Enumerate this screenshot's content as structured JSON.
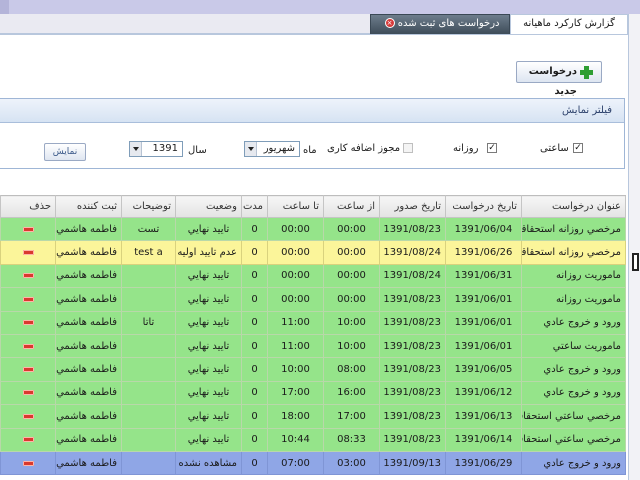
{
  "tabs": {
    "active_label": "گزارش کارکرد ماهیانه",
    "second_label": "درخواست های ثبت شده"
  },
  "toolbar": {
    "new_request_label": "درخواست جدید"
  },
  "filter": {
    "header": "فیلتر نمایش",
    "hourly_label": "ساعتی",
    "daily_label": "روزانه",
    "overtime_label": "مجوز اضافه کاری",
    "month_label": "ماه",
    "month_value": "شهریور",
    "year_label": "سال",
    "year_value": "1391",
    "show_button": "نمایش"
  },
  "columns": {
    "title": "عنوان درخواست",
    "request_date": "تاریخ درخواست",
    "issue_date": "تاریخ صدور",
    "from_hour": "از ساعت",
    "to_hour": "تا ساعت",
    "duration": "مدت",
    "status": "وضعیت",
    "notes": "توضیحات",
    "registrar": "ثبت کننده",
    "delete": "حذف"
  },
  "rows": [
    {
      "title": "مرخصي روزانه استحقاقي",
      "request_date": "1391/06/04",
      "issue_date": "1391/08/23",
      "from_hour": "00:00",
      "to_hour": "00:00",
      "duration": "0",
      "status": "تاييد نهايي",
      "notes": "تست",
      "registrar": "فاطمه هاشمي"
    },
    {
      "title": "مرخصي روزانه استحقاقي",
      "request_date": "1391/06/26",
      "issue_date": "1391/08/24",
      "from_hour": "00:00",
      "to_hour": "00:00",
      "duration": "0",
      "status": "عدم تاييد اوليه",
      "notes": "test a",
      "registrar": "فاطمه هاشمي"
    },
    {
      "title": "ماموريت روزانه",
      "request_date": "1391/06/31",
      "issue_date": "1391/08/24",
      "from_hour": "00:00",
      "to_hour": "00:00",
      "duration": "0",
      "status": "تاييد نهايي",
      "notes": "",
      "registrar": "فاطمه هاشمي"
    },
    {
      "title": "ماموريت روزانه",
      "request_date": "1391/06/01",
      "issue_date": "1391/08/23",
      "from_hour": "00:00",
      "to_hour": "00:00",
      "duration": "0",
      "status": "تاييد نهايي",
      "notes": "",
      "registrar": "فاطمه هاشمي"
    },
    {
      "title": "ورود و خروج عادي",
      "request_date": "1391/06/01",
      "issue_date": "1391/08/23",
      "from_hour": "10:00",
      "to_hour": "11:00",
      "duration": "0",
      "status": "تاييد نهايي",
      "notes": "تاتا",
      "registrar": "فاطمه هاشمي"
    },
    {
      "title": "ماموريت ساعتي",
      "request_date": "1391/06/01",
      "issue_date": "1391/08/23",
      "from_hour": "10:00",
      "to_hour": "11:00",
      "duration": "0",
      "status": "تاييد نهايي",
      "notes": "",
      "registrar": "فاطمه هاشمي"
    },
    {
      "title": "ورود و خروج عادي",
      "request_date": "1391/06/05",
      "issue_date": "1391/08/23",
      "from_hour": "08:00",
      "to_hour": "10:00",
      "duration": "0",
      "status": "تاييد نهايي",
      "notes": "",
      "registrar": "فاطمه هاشمي"
    },
    {
      "title": "ورود و خروج عادي",
      "request_date": "1391/06/12",
      "issue_date": "1391/08/23",
      "from_hour": "16:00",
      "to_hour": "17:00",
      "duration": "0",
      "status": "تاييد نهايي",
      "notes": "",
      "registrar": "فاطمه هاشمي"
    },
    {
      "title": "مرخصي ساعتي استحقاقي",
      "request_date": "1391/06/13",
      "issue_date": "1391/08/23",
      "from_hour": "17:00",
      "to_hour": "18:00",
      "duration": "0",
      "status": "تاييد نهايي",
      "notes": "",
      "registrar": "فاطمه هاشمي"
    },
    {
      "title": "مرخصي ساعتي استحقاقي",
      "request_date": "1391/06/14",
      "issue_date": "1391/08/23",
      "from_hour": "08:33",
      "to_hour": "10:44",
      "duration": "0",
      "status": "تاييد نهايي",
      "notes": "",
      "registrar": "فاطمه هاشمي"
    },
    {
      "title": "ورود و خروج عادي",
      "request_date": "1391/06/29",
      "issue_date": "1391/09/13",
      "from_hour": "03:00",
      "to_hour": "07:00",
      "duration": "0",
      "status": "مشاهده نشده",
      "notes": "",
      "registrar": "فاطمه هاشمي"
    }
  ],
  "row_colors": {
    "approved": "#95e48a",
    "rejected": "#fbf59a",
    "unseen": "#8fa6e6"
  }
}
